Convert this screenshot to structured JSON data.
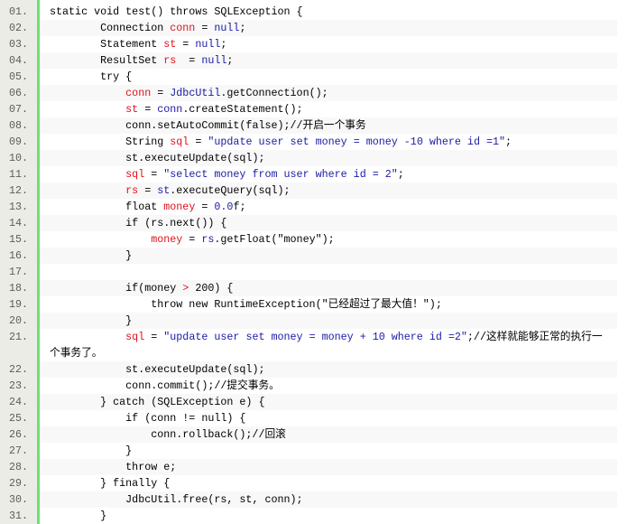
{
  "colors": {
    "variable": "#e0101a",
    "keyword": "#1a1aa6",
    "gutter_bar": "#6ce26c"
  },
  "lines": [
    {
      "n": "01.",
      "segs": [
        {
          "c": "",
          "t": "static void test() throws SQLException {"
        }
      ]
    },
    {
      "n": "02.",
      "segs": [
        {
          "c": "",
          "t": "        Connection "
        },
        {
          "c": "v",
          "t": "conn"
        },
        {
          "c": "",
          "t": " = "
        },
        {
          "c": "k",
          "t": "null"
        },
        {
          "c": "",
          "t": ";"
        }
      ]
    },
    {
      "n": "03.",
      "segs": [
        {
          "c": "",
          "t": "        Statement "
        },
        {
          "c": "v",
          "t": "st"
        },
        {
          "c": "",
          "t": " = "
        },
        {
          "c": "k",
          "t": "null"
        },
        {
          "c": "",
          "t": ";"
        }
      ]
    },
    {
      "n": "04.",
      "segs": [
        {
          "c": "",
          "t": "        ResultSet "
        },
        {
          "c": "v",
          "t": "rs"
        },
        {
          "c": "",
          "t": "  = "
        },
        {
          "c": "k",
          "t": "null"
        },
        {
          "c": "",
          "t": ";"
        }
      ]
    },
    {
      "n": "05.",
      "segs": [
        {
          "c": "",
          "t": "        try {"
        }
      ]
    },
    {
      "n": "06.",
      "segs": [
        {
          "c": "",
          "t": "            "
        },
        {
          "c": "v",
          "t": "conn"
        },
        {
          "c": "",
          "t": " = "
        },
        {
          "c": "k",
          "t": "JdbcUtil"
        },
        {
          "c": "",
          "t": ".getConnection();"
        }
      ]
    },
    {
      "n": "07.",
      "segs": [
        {
          "c": "",
          "t": "            "
        },
        {
          "c": "v",
          "t": "st"
        },
        {
          "c": "",
          "t": " = "
        },
        {
          "c": "k",
          "t": "conn"
        },
        {
          "c": "",
          "t": ".createStatement();"
        }
      ]
    },
    {
      "n": "08.",
      "segs": [
        {
          "c": "",
          "t": "            conn.setAutoCommit(false);//开启一个事务"
        }
      ]
    },
    {
      "n": "09.",
      "segs": [
        {
          "c": "",
          "t": "            String "
        },
        {
          "c": "v",
          "t": "sql"
        },
        {
          "c": "",
          "t": " = "
        },
        {
          "c": "k",
          "t": "\"update user set money = money -10 where id =1\""
        },
        {
          "c": "",
          "t": ";"
        }
      ]
    },
    {
      "n": "10.",
      "segs": [
        {
          "c": "",
          "t": "            st.executeUpdate(sql);"
        }
      ]
    },
    {
      "n": "11.",
      "segs": [
        {
          "c": "",
          "t": "            "
        },
        {
          "c": "v",
          "t": "sql"
        },
        {
          "c": "",
          "t": " = "
        },
        {
          "c": "k",
          "t": "\"select money from user where id = 2\""
        },
        {
          "c": "",
          "t": ";"
        }
      ]
    },
    {
      "n": "12.",
      "segs": [
        {
          "c": "",
          "t": "            "
        },
        {
          "c": "v",
          "t": "rs"
        },
        {
          "c": "",
          "t": " = "
        },
        {
          "c": "k",
          "t": "st"
        },
        {
          "c": "",
          "t": ".executeQuery(sql);"
        }
      ]
    },
    {
      "n": "13.",
      "segs": [
        {
          "c": "",
          "t": "            float "
        },
        {
          "c": "v",
          "t": "money"
        },
        {
          "c": "",
          "t": " = "
        },
        {
          "c": "k",
          "t": "0.0"
        },
        {
          "c": "",
          "t": "f;"
        }
      ]
    },
    {
      "n": "14.",
      "segs": [
        {
          "c": "",
          "t": "            if (rs.next()) {"
        }
      ]
    },
    {
      "n": "15.",
      "segs": [
        {
          "c": "",
          "t": "                "
        },
        {
          "c": "v",
          "t": "money"
        },
        {
          "c": "",
          "t": " = "
        },
        {
          "c": "k",
          "t": "rs"
        },
        {
          "c": "",
          "t": ".getFloat(\"money\");"
        }
      ]
    },
    {
      "n": "16.",
      "segs": [
        {
          "c": "",
          "t": "            }"
        }
      ]
    },
    {
      "n": "17.",
      "segs": [
        {
          "c": "",
          "t": " "
        }
      ]
    },
    {
      "n": "18.",
      "segs": [
        {
          "c": "",
          "t": "            if(money "
        },
        {
          "c": "v",
          "t": ">"
        },
        {
          "c": "",
          "t": " 200) {"
        }
      ]
    },
    {
      "n": "19.",
      "segs": [
        {
          "c": "",
          "t": "                throw new RuntimeException(\"已经超过了最大值！\");"
        }
      ]
    },
    {
      "n": "20.",
      "segs": [
        {
          "c": "",
          "t": "            }"
        }
      ]
    },
    {
      "n": "21.",
      "segs": [
        {
          "c": "",
          "t": "            "
        },
        {
          "c": "v",
          "t": "sql"
        },
        {
          "c": "",
          "t": " = "
        },
        {
          "c": "k",
          "t": "\"update user set money = money + 10 where id =2\""
        },
        {
          "c": "",
          "t": ";//这样就能够正常的执行一个事务了。"
        }
      ]
    },
    {
      "n": "22.",
      "segs": [
        {
          "c": "",
          "t": "            st.executeUpdate(sql);"
        }
      ]
    },
    {
      "n": "23.",
      "segs": [
        {
          "c": "",
          "t": "            conn.commit();//提交事务。"
        }
      ]
    },
    {
      "n": "24.",
      "segs": [
        {
          "c": "",
          "t": "        } catch (SQLException e) {"
        }
      ]
    },
    {
      "n": "25.",
      "segs": [
        {
          "c": "",
          "t": "            if (conn != null) {"
        }
      ]
    },
    {
      "n": "26.",
      "segs": [
        {
          "c": "",
          "t": "                conn.rollback();//回滚"
        }
      ]
    },
    {
      "n": "27.",
      "segs": [
        {
          "c": "",
          "t": "            }"
        }
      ]
    },
    {
      "n": "28.",
      "segs": [
        {
          "c": "",
          "t": "            throw e;"
        }
      ]
    },
    {
      "n": "29.",
      "segs": [
        {
          "c": "",
          "t": "        } finally {"
        }
      ]
    },
    {
      "n": "30.",
      "segs": [
        {
          "c": "",
          "t": "            JdbcUtil.free(rs, st, conn);"
        }
      ]
    },
    {
      "n": "31.",
      "segs": [
        {
          "c": "",
          "t": "        }"
        }
      ]
    }
  ]
}
